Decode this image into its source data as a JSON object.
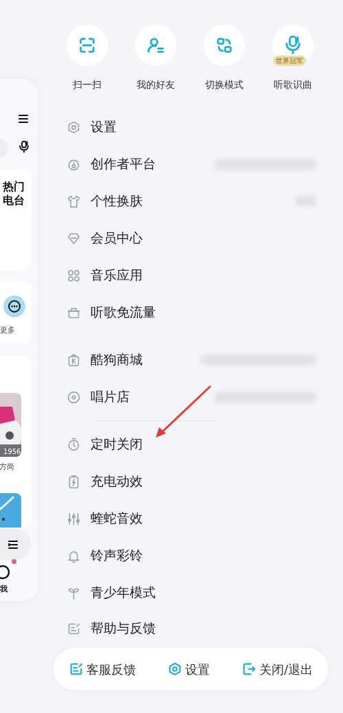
{
  "background_page": {
    "card_title": [
      "热门",
      "电台"
    ],
    "more_label": "更多",
    "album_year": "1956",
    "album_caption": "方尚",
    "nav_label": "我",
    "nav_badge": true
  },
  "quick_actions": [
    {
      "label": "扫一扫"
    },
    {
      "label": "我的好友"
    },
    {
      "label": "切换模式"
    },
    {
      "label": "听歌识曲",
      "badge": "世界冠军"
    }
  ],
  "menu_sections": [
    {
      "items": [
        {
          "label": "设置",
          "value_hidden": false
        },
        {
          "label": "创作者平台",
          "value_hidden": true
        },
        {
          "label": "个性换肤",
          "value_hidden": true
        },
        {
          "label": "会员中心",
          "value_hidden": false
        },
        {
          "label": "音乐应用",
          "value_hidden": false
        },
        {
          "label": "听歌免流量",
          "value_hidden": false
        }
      ]
    },
    {
      "items": [
        {
          "label": "酷狗商城",
          "value_hidden": true
        },
        {
          "label": "唱片店",
          "value_hidden": true
        }
      ]
    },
    {
      "items": [
        {
          "label": "定时关闭",
          "value_hidden": false
        },
        {
          "label": "充电动效",
          "value_hidden": false
        },
        {
          "label": "蝰蛇音效",
          "value_hidden": false
        },
        {
          "label": "铃声彩铃",
          "value_hidden": false
        },
        {
          "label": "青少年模式",
          "value_hidden": false
        },
        {
          "label": "帮助与反馈",
          "value_hidden": false
        }
      ]
    }
  ],
  "bottom_bar": [
    {
      "label": "客服反馈"
    },
    {
      "label": "设置"
    },
    {
      "label": "关闭/退出"
    }
  ]
}
